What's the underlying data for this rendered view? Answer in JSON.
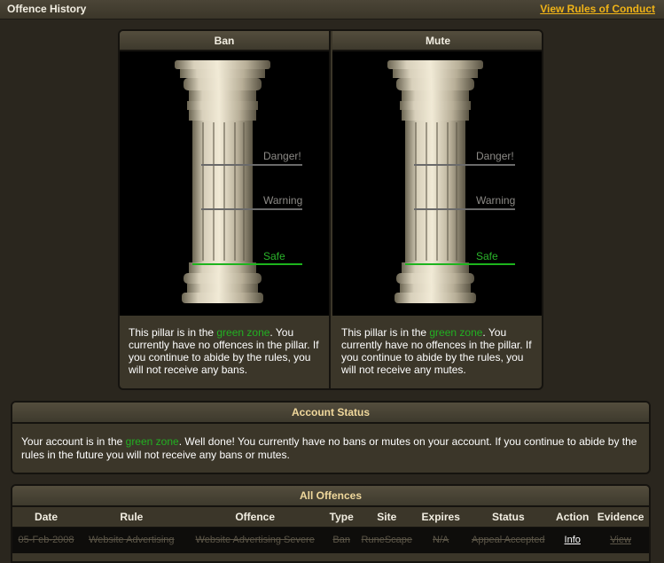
{
  "topbar": {
    "title": "Offence History",
    "rules_link": "View Rules of Conduct"
  },
  "pillars": [
    {
      "header": "Ban",
      "zones": {
        "danger": "Danger!",
        "warning": "Warning",
        "safe": "Safe"
      },
      "level": "safe",
      "text_before": "This pillar is in the ",
      "text_zone": "green zone",
      "text_after": ". You currently have no offences in the pillar. If you continue to abide by the rules, you will not receive any bans."
    },
    {
      "header": "Mute",
      "zones": {
        "danger": "Danger!",
        "warning": "Warning",
        "safe": "Safe"
      },
      "level": "safe",
      "text_before": "This pillar is in the ",
      "text_zone": "green zone",
      "text_after": ". You currently have no offences in the pillar. If you continue to abide by the rules, you will not receive any mutes."
    }
  ],
  "account_status": {
    "header": "Account Status",
    "text_before": "Your account is in the ",
    "text_zone": "green zone",
    "text_after": ". Well done! You currently have no bans or mutes on your account. If you continue to abide by the rules in the future you will not receive any bans or mutes."
  },
  "offences": {
    "header": "All Offences",
    "columns": [
      "Date",
      "Rule",
      "Offence",
      "Type",
      "Site",
      "Expires",
      "Status",
      "Action",
      "Evidence"
    ],
    "rows": [
      {
        "date": "05-Feb-2008",
        "rule": "Website Advertising",
        "offence": "Website Advertising Severe",
        "type": "Ban",
        "site": "RuneScape",
        "expires": "N/A",
        "status": "Appeal Accepted",
        "action": "Info",
        "evidence": "View"
      }
    ]
  },
  "colors": {
    "background": "#2a261e",
    "panel": "#3b3629",
    "link_gold": "#f0b317",
    "green_zone": "#22b022",
    "header_gold": "#f0d89c"
  }
}
